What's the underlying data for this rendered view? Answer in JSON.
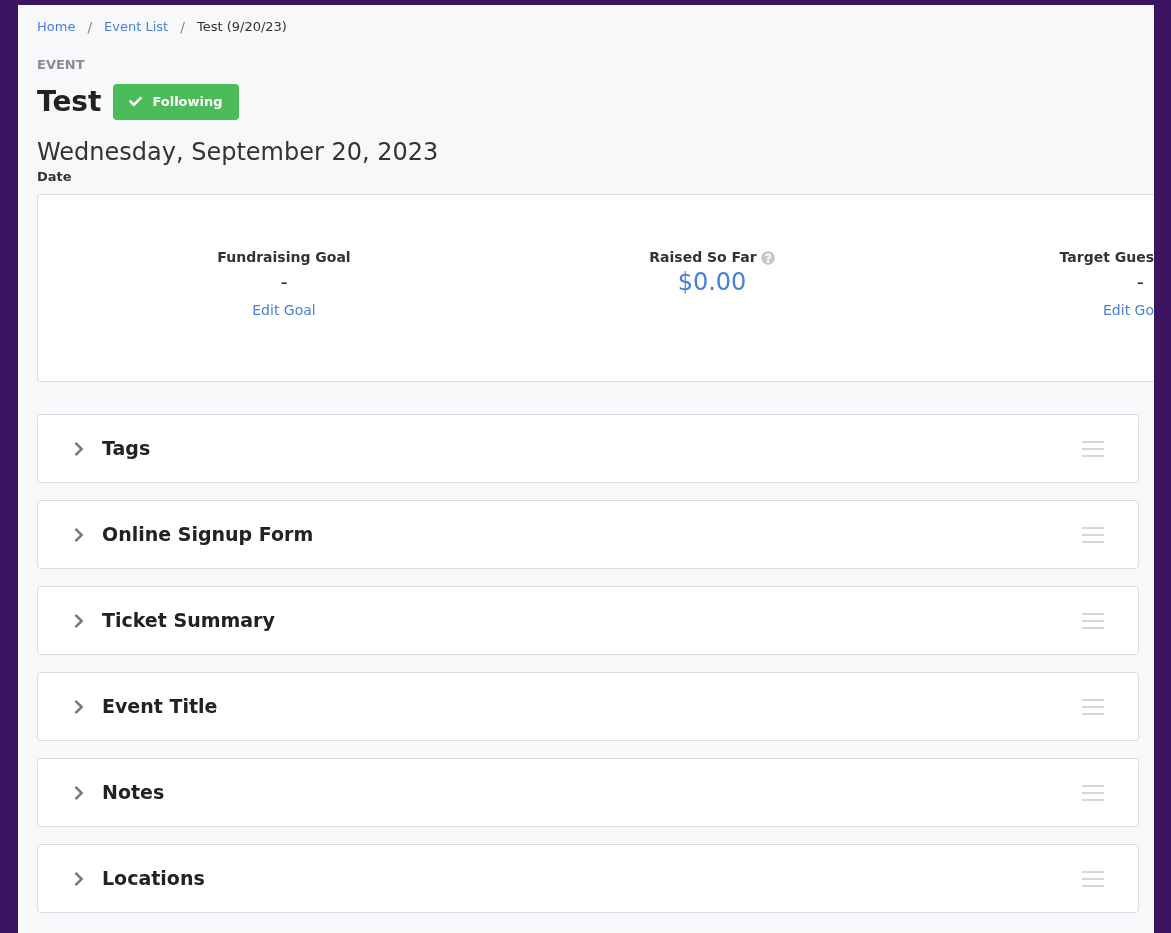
{
  "breadcrumb": [
    {
      "label": "Home",
      "link": true
    },
    {
      "label": "Event List",
      "link": true
    },
    {
      "label": "Test (9/20/23)",
      "link": false
    }
  ],
  "breadcrumb_separator": "/",
  "header": {
    "eyebrow": "EVENT",
    "title": "Test",
    "follow_button": {
      "label": "Following",
      "following": true
    }
  },
  "date": {
    "value": "Wednesday, September 20, 2023",
    "label": "Date"
  },
  "stats": [
    {
      "label": "Fundraising Goal",
      "value": "-",
      "link": "Edit Goal",
      "kind": "goal"
    },
    {
      "label": "Raised So Far",
      "value": "$0.00",
      "kind": "raised"
    },
    {
      "label": "Target Gues",
      "value": "-",
      "link": "Edit Go",
      "kind": "cut"
    }
  ],
  "sections": [
    {
      "title": "Tags",
      "expanded": false
    },
    {
      "title": "Online Signup Form",
      "expanded": false
    },
    {
      "title": "Ticket Summary",
      "expanded": false
    },
    {
      "title": "Event Title",
      "expanded": false
    },
    {
      "title": "Notes",
      "expanded": false
    },
    {
      "title": "Locations",
      "expanded": false
    }
  ]
}
